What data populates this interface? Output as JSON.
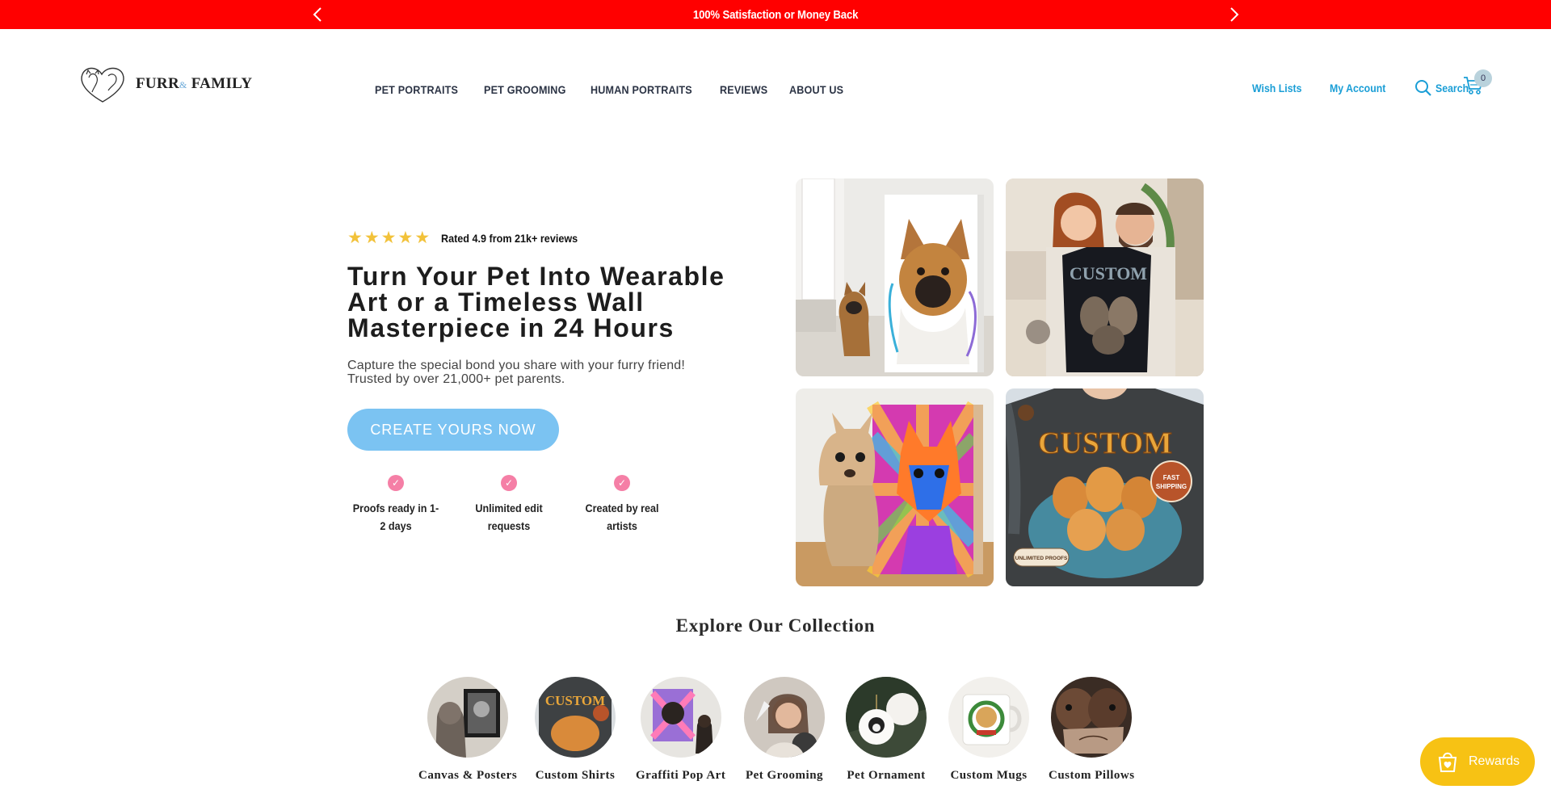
{
  "announcement": {
    "text": "100% Satisfaction or Money Back"
  },
  "header": {
    "logo_text_left": "FURR",
    "logo_amp": "&",
    "logo_text_right": "FAMILY",
    "nav": [
      "PET PORTRAITS",
      "PET GROOMING",
      "HUMAN PORTRAITS",
      "REVIEWS",
      "ABOUT US"
    ],
    "wish_lists": "Wish Lists",
    "my_account": "My Account",
    "search": "Search",
    "cart_count": "0"
  },
  "hero": {
    "rating_stars": 5,
    "rating_text": "Rated 4.9 from 21k+ reviews",
    "title": "Turn Your Pet Into Wearable Art or a Timeless Wall Masterpiece in 24 Hours",
    "subtitle": "Capture the special bond you share with your furry friend! Trusted by over 21,000+ pet parents.",
    "cta": "CREATE YOURS NOW",
    "features": [
      "Proofs ready in 1-2 days",
      "Unlimited edit requests",
      "Created by real artists"
    ],
    "tiles": [
      {
        "name": "french-bulldog-canvas"
      },
      {
        "name": "couple-custom-shirt",
        "overlay": "CUSTOM"
      },
      {
        "name": "chihuahua-pop-art"
      },
      {
        "name": "golden-retriever-shirt",
        "overlay": "CUSTOM",
        "badge": "FAST SHIPPING",
        "badge2": "UNLIMITED PROOFS"
      }
    ]
  },
  "collection": {
    "title": "Explore Our Collection",
    "items": [
      "Canvas & Posters",
      "Custom Shirts",
      "Graffiti Pop Art",
      "Pet Grooming",
      "Pet Ornament",
      "Custom Mugs",
      "Custom Pillows"
    ]
  },
  "rewards": {
    "label": "Rewards"
  },
  "colors": {
    "announcement_bg": "#ff0000",
    "link_blue": "#1a9ed6",
    "cta_bg": "#7bc3f2",
    "check_pink": "#f57fa6",
    "star_gold": "#f2c23a",
    "rewards_bg": "#f7c214"
  }
}
